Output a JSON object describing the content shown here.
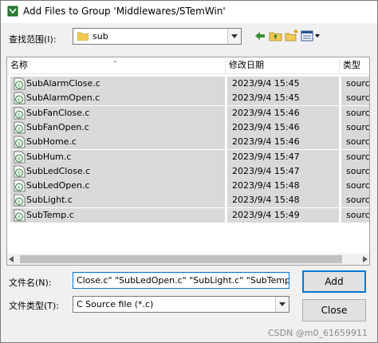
{
  "window": {
    "title": "Add Files to Group 'Middlewares/STemWin'"
  },
  "lookin": {
    "label": "查找范围(I):",
    "value": "sub"
  },
  "columns": {
    "name": "名称",
    "date": "修改日期",
    "type": "类型"
  },
  "files": [
    {
      "name": "SubAlarmClose.c",
      "date": "2023/9/4 15:45",
      "type": "source"
    },
    {
      "name": "SubAlarmOpen.c",
      "date": "2023/9/4 15:45",
      "type": "source"
    },
    {
      "name": "SubFanClose.c",
      "date": "2023/9/4 15:46",
      "type": "source"
    },
    {
      "name": "SubFanOpen.c",
      "date": "2023/9/4 15:46",
      "type": "source"
    },
    {
      "name": "SubHome.c",
      "date": "2023/9/4 15:46",
      "type": "source"
    },
    {
      "name": "SubHum.c",
      "date": "2023/9/4 15:47",
      "type": "source"
    },
    {
      "name": "SubLedClose.c",
      "date": "2023/9/4 15:47",
      "type": "source"
    },
    {
      "name": "SubLedOpen.c",
      "date": "2023/9/4 15:48",
      "type": "source"
    },
    {
      "name": "SubLight.c",
      "date": "2023/9/4 15:48",
      "type": "source"
    },
    {
      "name": "SubTemp.c",
      "date": "2023/9/4 15:49",
      "type": "source"
    }
  ],
  "filename": {
    "label": "文件名(N):",
    "value": "Close.c\" \"SubLedOpen.c\" \"SubLight.c\" \"SubTemp.c\""
  },
  "filetype": {
    "label": "文件类型(T):",
    "value": "C Source file (*.c)"
  },
  "buttons": {
    "add": "Add",
    "close": "Close"
  },
  "watermark": "CSDN @m0_61659911",
  "colors": {
    "selection": "#d9d9d9",
    "accent": "#0078d7",
    "folder": "#f3c94f"
  }
}
